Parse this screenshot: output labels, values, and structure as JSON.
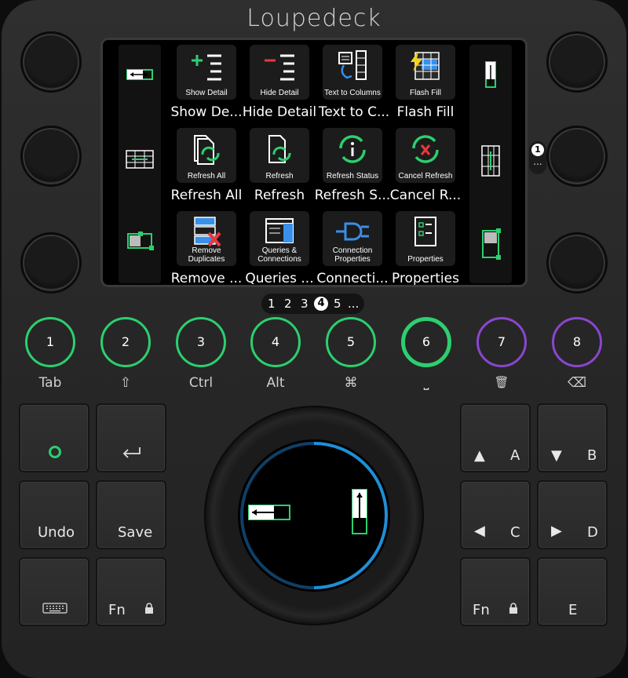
{
  "brand": {
    "logo_text": "Loupedeck"
  },
  "pager": {
    "pages": [
      "1",
      "2",
      "3"
    ],
    "current": "4",
    "next": "5",
    "more": "..."
  },
  "page_badge": {
    "number": "1",
    "more": "..."
  },
  "tiles": [
    {
      "icon_label": "Show Detail",
      "caption": "Show De..."
    },
    {
      "icon_label": "Hide Detail",
      "caption": "Hide Detail"
    },
    {
      "icon_label": "Text to Columns",
      "caption": "Text to C..."
    },
    {
      "icon_label": "Flash Fill",
      "caption": "Flash Fill"
    },
    {
      "icon_label": "Refresh All",
      "caption": "Refresh All"
    },
    {
      "icon_label": "Refresh",
      "caption": "Refresh"
    },
    {
      "icon_label": "Refresh Status",
      "caption": "Refresh S..."
    },
    {
      "icon_label": "Cancel Refresh",
      "caption": "Cancel R..."
    },
    {
      "icon_label": "Remove Duplicates",
      "caption": "Remove ..."
    },
    {
      "icon_label": "Queries & Connections",
      "caption": "Queries ..."
    },
    {
      "icon_label": "Connection Properties",
      "caption": "Connecti..."
    },
    {
      "icon_label": "Properties",
      "caption": "Properties"
    }
  ],
  "round_buttons": [
    {
      "number": "1",
      "label": "Tab",
      "color": "#2ccf6e"
    },
    {
      "number": "2",
      "label": "⇧",
      "color": "#2ccf6e"
    },
    {
      "number": "3",
      "label": "Ctrl",
      "color": "#2ccf6e"
    },
    {
      "number": "4",
      "label": "Alt",
      "color": "#2ccf6e"
    },
    {
      "number": "5",
      "label": "⌘",
      "color": "#2ccf6e"
    },
    {
      "number": "6",
      "label": "⎵",
      "color": "#2ccf6e"
    },
    {
      "number": "7",
      "label": "🗑",
      "color": "#8a46cf"
    },
    {
      "number": "8",
      "label": "⌫",
      "color": "#8a46cf"
    }
  ],
  "left_keys": {
    "undo": "Undo",
    "save": "Save",
    "fn": "Fn"
  },
  "right_keys": {
    "a": "A",
    "b": "B",
    "c": "C",
    "d": "D",
    "fn": "Fn",
    "e": "E"
  },
  "colors": {
    "accent_green": "#2ccf6e",
    "accent_purple": "#8a46cf",
    "dial_ring": "#1e8fd6"
  }
}
